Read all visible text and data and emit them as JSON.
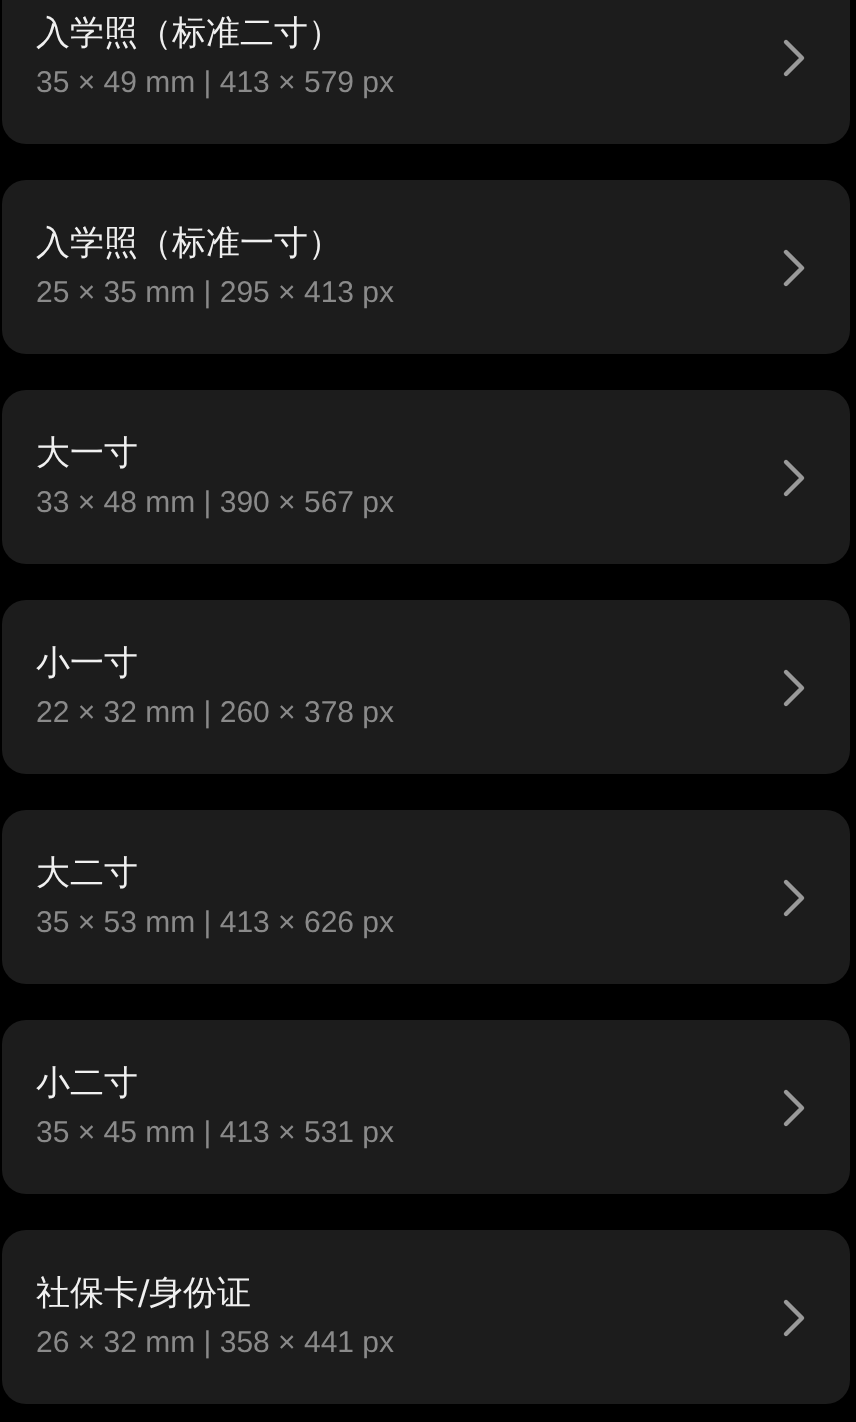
{
  "items": [
    {
      "title": "入学照（标准二寸）",
      "size": "35 × 49 mm | 413 × 579 px"
    },
    {
      "title": "入学照（标准一寸）",
      "size": "25 × 35 mm | 295 × 413 px"
    },
    {
      "title": "大一寸",
      "size": "33 × 48 mm | 390 × 567 px"
    },
    {
      "title": "小一寸",
      "size": "22 × 32 mm | 260 × 378 px"
    },
    {
      "title": "大二寸",
      "size": "35 × 53 mm | 413 × 626 px"
    },
    {
      "title": "小二寸",
      "size": "35 × 45 mm | 413 × 531 px"
    },
    {
      "title": "社保卡/身份证",
      "size": "26 × 32 mm | 358 × 441 px"
    }
  ]
}
